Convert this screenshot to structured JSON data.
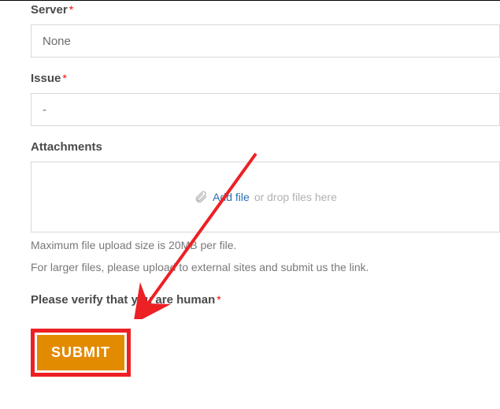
{
  "fields": {
    "server": {
      "label": "Server",
      "value": "None"
    },
    "issue": {
      "label": "Issue",
      "value": "-"
    },
    "attachments": {
      "label": "Attachments",
      "addFile": "Add file",
      "dropHint": "or drop files here",
      "help1": "Maximum file upload size is 20MB per file.",
      "help2": "For larger files, please upload to external sites and submit us the link."
    }
  },
  "verify": {
    "label": "Please verify that you are human"
  },
  "submit": {
    "label": "SUBMIT"
  },
  "required_marker": "*"
}
